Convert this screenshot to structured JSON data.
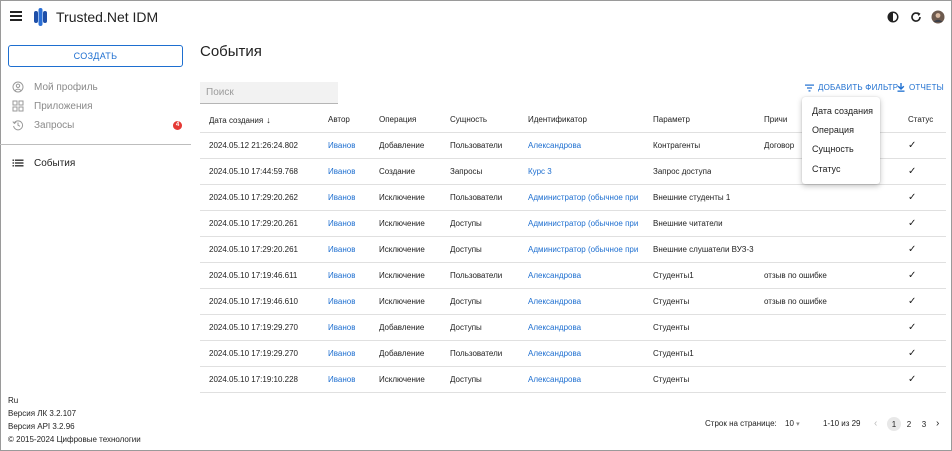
{
  "header": {
    "app_title": "Trusted.Net IDM"
  },
  "sidebar": {
    "create_label": "СОЗДАТЬ",
    "items": [
      {
        "label": "Мой профиль",
        "icon": "user-circle-icon"
      },
      {
        "label": "Приложения",
        "icon": "apps-grid-icon"
      },
      {
        "label": "Запросы",
        "icon": "history-icon",
        "badge": "4"
      },
      {
        "label": "События",
        "icon": "list-icon"
      }
    ],
    "footer": {
      "lang": "Ru",
      "version_lk": "Версия ЛК 3.2.107",
      "version_api": "Версия API 3.2.96",
      "copyright": "© 2015-2024 Цифровые технологии"
    }
  },
  "main": {
    "title": "События",
    "search_placeholder": "Поиск",
    "add_filter_label": "ДОБАВИТЬ ФИЛЬТР",
    "reports_label": "ОТЧЕТЫ"
  },
  "table": {
    "columns": [
      "Дата создания",
      "Автор",
      "Операция",
      "Сущность",
      "Идентификатор",
      "Параметр",
      "Причи",
      "Статус"
    ],
    "rows": [
      {
        "date": "2024.05.12 21:26:24.802",
        "author": "Иванов",
        "op": "Добавление",
        "entity": "Пользователи",
        "ident": "Александрова",
        "param": "Контрагенты",
        "reason": "Договор"
      },
      {
        "date": "2024.05.10 17:44:59.768",
        "author": "Иванов",
        "op": "Создание",
        "entity": "Запросы",
        "ident": "Курс 3",
        "param": "Запрос доступа",
        "reason": ""
      },
      {
        "date": "2024.05.10 17:29:20.262",
        "author": "Иванов",
        "op": "Исключение",
        "entity": "Пользователи",
        "ident": "Администратор (обычное при",
        "param": "Внешние студенты 1",
        "reason": ""
      },
      {
        "date": "2024.05.10 17:29:20.261",
        "author": "Иванов",
        "op": "Исключение",
        "entity": "Доступы",
        "ident": "Администратор (обычное при",
        "param": "Внешние читатели",
        "reason": ""
      },
      {
        "date": "2024.05.10 17:29:20.261",
        "author": "Иванов",
        "op": "Исключение",
        "entity": "Доступы",
        "ident": "Администратор (обычное при",
        "param": "Внешние слушатели ВУЗ-3",
        "reason": ""
      },
      {
        "date": "2024.05.10 17:19:46.611",
        "author": "Иванов",
        "op": "Исключение",
        "entity": "Пользователи",
        "ident": "Александрова",
        "param": "Студенты1",
        "reason": "отзыв по ошибке"
      },
      {
        "date": "2024.05.10 17:19:46.610",
        "author": "Иванов",
        "op": "Исключение",
        "entity": "Доступы",
        "ident": "Александрова",
        "param": "Студенты",
        "reason": "отзыв по ошибке"
      },
      {
        "date": "2024.05.10 17:19:29.270",
        "author": "Иванов",
        "op": "Добавление",
        "entity": "Доступы",
        "ident": "Александрова",
        "param": "Студенты",
        "reason": ""
      },
      {
        "date": "2024.05.10 17:19:29.270",
        "author": "Иванов",
        "op": "Добавление",
        "entity": "Пользователи",
        "ident": "Александрова",
        "param": "Студенты1",
        "reason": ""
      },
      {
        "date": "2024.05.10 17:19:10.228",
        "author": "Иванов",
        "op": "Исключение",
        "entity": "Доступы",
        "ident": "Александрова",
        "param": "Студенты",
        "reason": ""
      }
    ],
    "status_icon": "check-icon"
  },
  "pagination": {
    "rows_per_page_label": "Строк на странице:",
    "rows_per_page_value": "10",
    "range_label": "1-10 из 29",
    "pages": [
      "1",
      "2",
      "3"
    ]
  },
  "filter_menu": {
    "items": [
      "Дата создания",
      "Операция",
      "Сущность",
      "Статус"
    ]
  },
  "colors": {
    "accent": "#1e6fd0",
    "badge": "#e53935"
  }
}
